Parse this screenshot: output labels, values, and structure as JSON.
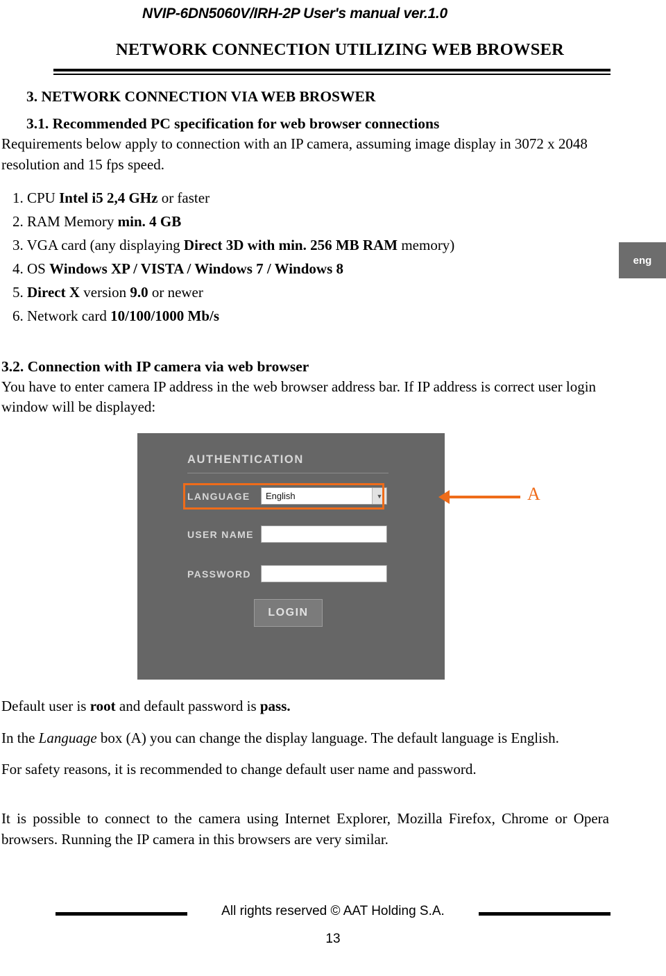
{
  "header": {
    "running_head": "NVIP-6DN5060V/IRH-2P User's manual ver.1.0",
    "doc_title": "NETWORK CONNECTION UTILIZING WEB BROWSER"
  },
  "lang_tab": {
    "label": "eng"
  },
  "section3": {
    "heading": "3. NETWORK CONNECTION VIA WEB BROSWER",
    "sub31_heading": "3.1. Recommended PC specification for web browser connections",
    "sub31_text": "Requirements below apply to connection with an IP camera, assuming image display in 3072 x 2048 resolution and 15 fps speed.",
    "requirements": [
      {
        "num": "1.",
        "plain1": "CPU ",
        "bold": "Intel i5 2,4 GHz",
        "plain2": " or faster"
      },
      {
        "num": "2.",
        "plain1": "RAM Memory ",
        "bold": "min. 4 GB",
        "plain2": ""
      },
      {
        "num": "3.",
        "plain1": "VGA card (any displaying ",
        "bold": "Direct 3D with min. 256 MB RAM",
        "plain2": " memory)"
      },
      {
        "num": "4.",
        "plain1": "OS ",
        "bold": "Windows XP / VISTA / Windows 7 / Windows 8",
        "plain2": ""
      },
      {
        "num": "5.",
        "plain1": "",
        "bold": "Direct X",
        "plain2": " version ",
        "bold2": "9.0",
        "plain3": " or newer"
      },
      {
        "num": "6.",
        "plain1": "Network card ",
        "bold": "10/100/1000 Mb/s",
        "plain2": ""
      }
    ]
  },
  "section32": {
    "heading": "3.2. Connection with IP camera via web browser",
    "text": "You have to enter camera IP address in the web browser address bar. If IP address is correct user login window will be displayed:"
  },
  "login_screenshot": {
    "title": "AUTHENTICATION",
    "language_label": "LANGUAGE",
    "language_value": "English",
    "username_label": "USER NAME",
    "username_value": "",
    "password_label": "PASSWORD",
    "password_value": "",
    "login_button": "LOGIN",
    "callout_letter": "A",
    "highlight_color": "#ef6c1a",
    "background_color": "#666666"
  },
  "closing": {
    "line1_a": "Default user is ",
    "line1_b": "root",
    "line1_c": " and default password is ",
    "line1_d": "pass.",
    "line2_a": "In the ",
    "line2_b": "Language",
    "line2_c": " box (A) you can change the display language. The default language is English.",
    "line3": "For safety reasons, it is recommended to change default user name and password.",
    "line4": "It is possible to connect to the camera using Internet Explorer, Mozilla Firefox, Chrome or Opera browsers. Running the IP camera in this browsers are very similar."
  },
  "footer": {
    "copyright": "All rights reserved © AAT Holding S.A.",
    "page_number": "13"
  }
}
